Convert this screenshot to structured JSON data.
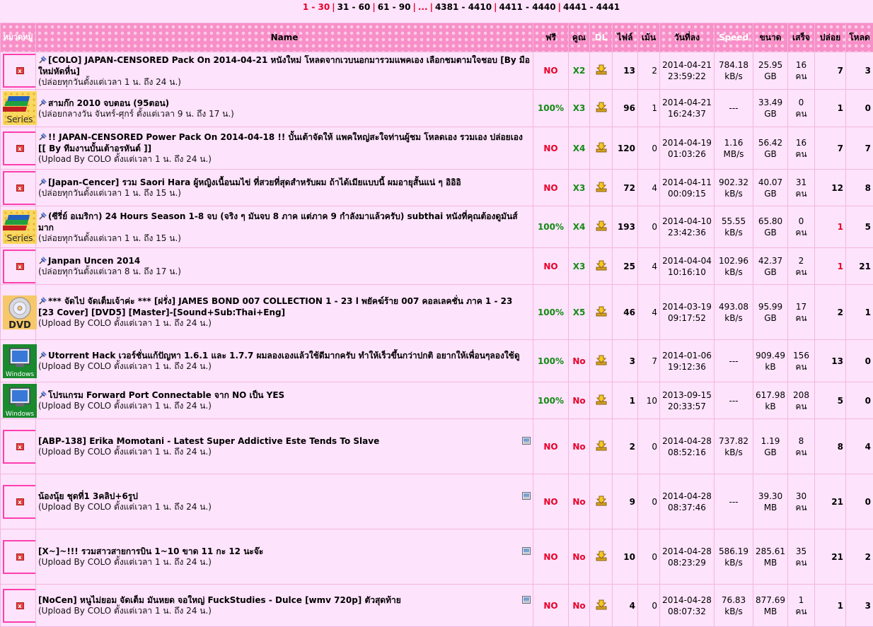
{
  "pager": [
    {
      "label": "1 - 30",
      "current": true
    },
    {
      "label": "31 - 60"
    },
    {
      "label": "61 - 90"
    },
    {
      "label": "...",
      "dots": true
    },
    {
      "label": "4381 - 4410"
    },
    {
      "label": "4411 - 4440"
    },
    {
      "label": "4441 - 4441"
    }
  ],
  "headers": {
    "category": "หมวดหมู่",
    "name": "Name",
    "free": "ฟรี",
    "multiplier": "คูณ",
    "dl": "DL",
    "files": "ไฟล์",
    "comments": "เม้น",
    "date": "วันที่ลง",
    "speed": "Speed",
    "size": "ขนาด",
    "completed": "เสร็จ",
    "seeders": "ปล่อย",
    "leechers": "โหลด"
  },
  "colors": {
    "header_bg": "#f88fc8",
    "row_bg": "#fde3fb",
    "red": "#e8002a",
    "green": "#138a13",
    "border_pink": "#ff3fb0"
  },
  "rows": [
    {
      "cat": "broken",
      "pinned": true,
      "new": false,
      "title": "[COLO] JAPAN-CENSORED Pack On 2014-04-21 หนังใหม่ โหลดจากเวบนอกมารวมแพคเอง เลือกชมตามใจชอบ [By มือใหม่หัดหื่น]",
      "sub": "(ปล่อยทุกวันตั้งแต่เวลา 1 น. ถึง 24 น.)",
      "free": "NO",
      "mult": "X2",
      "files": "13",
      "comments": "2",
      "date": "2014-04-21",
      "time": "23:59:22",
      "speed1": "784.18",
      "speed2": "kB/s",
      "size1": "25.95",
      "size2": "GB",
      "done1": "16",
      "done2": "คน",
      "seed": "7",
      "seed_red": false,
      "leech": "3",
      "h": 53
    },
    {
      "cat": "series",
      "cat_label": "Series",
      "pinned": true,
      "new": false,
      "title": "สามก๊ก 2010 จบตอน (95ตอน)",
      "sub": "(ปล่อยกลางวัน จันทร์-ศุกร์ ตั้งแต่เวลา 9 น. ถึง 17 น.)",
      "free": "100%",
      "mult": "X3",
      "files": "96",
      "comments": "1",
      "date": "2014-04-21",
      "time": "16:24:37",
      "speed1": "---",
      "speed2": "",
      "size1": "33.49",
      "size2": "GB",
      "done1": "0",
      "done2": "คน",
      "seed": "1",
      "seed_red": false,
      "leech": "0",
      "h": 53
    },
    {
      "cat": "broken",
      "pinned": true,
      "new": false,
      "title": "!! JAPAN-CENSORED Power Pack On 2014-04-18 !! บั้นเต้าจัดให้ แพคใหญ่สะใจท่านผู้ชม โหลดเอง รวมเอง ปล่อยเอง [[ By ทีมงานบั้นเต้าอรหันต์ ]]",
      "sub": "(Upload By COLO ตั้งแต่เวลา 1 น. ถึง 24 น.)",
      "free": "NO",
      "mult": "X4",
      "files": "120",
      "comments": "0",
      "date": "2014-04-19",
      "time": "01:03:26",
      "speed1": "1.16",
      "speed2": "MB/s",
      "size1": "56.42",
      "size2": "GB",
      "done1": "16",
      "done2": "คน",
      "seed": "7",
      "seed_red": false,
      "leech": "7",
      "h": 60
    },
    {
      "cat": "broken",
      "pinned": true,
      "new": false,
      "title": "[Japan-Cencer] รวม Saori Hara ผู้หญิงเนื้อนมไข่ ที่สวยที่สุดสำหรับผม ถ้าได้เมียแบบนี้ ผมอายุสั้นแน่ ๆ อิอิอิ",
      "sub": "(ปล่อยทุกวันตั้งแต่เวลา 1 น. ถึง 15 น.)",
      "free": "NO",
      "mult": "X3",
      "files": "72",
      "comments": "4",
      "date": "2014-04-11",
      "time": "00:09:15",
      "speed1": "902.32",
      "speed2": "kB/s",
      "size1": "40.07",
      "size2": "GB",
      "done1": "31",
      "done2": "คน",
      "seed": "12",
      "seed_red": false,
      "leech": "8",
      "h": 52
    },
    {
      "cat": "series",
      "cat_label": "Series",
      "pinned": true,
      "new": false,
      "title": "(ซีรี่ย์ อเมริกา) 24 Hours Season 1-8 จบ (จริง ๆ มันจบ 8 ภาค แต่ภาค 9 กำลังมาแล้วครับ) subthai หนังที่คุณต้องดูมันส์มาก",
      "sub": "(ปล่อยทุกวันตั้งแต่เวลา 1 น. ถึง 15 น.)",
      "free": "100%",
      "mult": "X4",
      "files": "193",
      "comments": "0",
      "date": "2014-04-10",
      "time": "23:42:36",
      "speed1": "55.55",
      "speed2": "kB/s",
      "size1": "65.80",
      "size2": "GB",
      "done1": "0",
      "done2": "คน",
      "seed": "1",
      "seed_red": true,
      "leech": "5",
      "h": 59
    },
    {
      "cat": "broken",
      "pinned": true,
      "new": false,
      "title": "Janpan Uncen 2014",
      "sub": "(ปล่อยทุกวันตั้งแต่เวลา 8 น. ถึง 17 น.)",
      "free": "NO",
      "mult": "X3",
      "files": "25",
      "comments": "4",
      "date": "2014-04-04",
      "time": "10:16:10",
      "speed1": "102.96",
      "speed2": "kB/s",
      "size1": "42.37",
      "size2": "GB",
      "done1": "2",
      "done2": "คน",
      "seed": "1",
      "seed_red": true,
      "leech": "21",
      "h": 52
    },
    {
      "cat": "dvd",
      "cat_label": "DVD",
      "pinned": true,
      "new": false,
      "title": "*** จัดไป จัดเต็มเจ้าค่ะ *** [ฝรั่ง] JAMES BOND 007 COLLECTION 1 - 23 l พยัคฆ์ร้าย 007 คอลเลคชั่น ภาค 1 - 23 [23 Cover] [DVD5] [Master]-[Sound+Sub:Thai+Eng]",
      "sub": "(Upload By COLO ตั้งแต่เวลา 1 น. ถึง 24 น.)",
      "free": "100%",
      "mult": "X5",
      "files": "46",
      "comments": "4",
      "date": "2014-03-19",
      "time": "09:17:52",
      "speed1": "493.08",
      "speed2": "kB/s",
      "size1": "95.99",
      "size2": "GB",
      "done1": "17",
      "done2": "คน",
      "seed": "2",
      "seed_red": false,
      "leech": "1",
      "h": 78
    },
    {
      "cat": "windows",
      "cat_label": "Windows",
      "pinned": true,
      "new": false,
      "title": "Utorrent Hack เวอร์ชั่นแก้ปัญหา 1.6.1 และ 1.7.7 ผมลองเองแล้วใช้ดีมากครับ ทำให้เร็วขึ้นกว่าปกติ อยากให้เพื่อนๆลองใช้ดู",
      "sub": "(Upload By COLO ตั้งแต่เวลา 1 น. ถึง 24 น.)",
      "free": "100%",
      "mult": "No",
      "mult_red": true,
      "files": "3",
      "comments": "7",
      "date": "2014-01-06",
      "time": "19:12:36",
      "speed1": "---",
      "speed2": "",
      "size1": "909.49",
      "size2": "kB",
      "done1": "156",
      "done2": "คน",
      "seed": "13",
      "seed_red": false,
      "leech": "0",
      "h": 60
    },
    {
      "cat": "windows",
      "cat_label": "Windows",
      "pinned": true,
      "new": false,
      "title": "โปรแกรม Forward Port Connectable จาก NO เป็น YES",
      "sub": "(Upload By COLO ตั้งแต่เวลา 1 น. ถึง 24 น.)",
      "free": "100%",
      "mult": "No",
      "mult_red": true,
      "files": "1",
      "comments": "10",
      "date": "2013-09-15",
      "time": "20:33:57",
      "speed1": "---",
      "speed2": "",
      "size1": "617.98",
      "size2": "kB",
      "done1": "208",
      "done2": "คน",
      "seed": "5",
      "seed_red": false,
      "leech": "0",
      "h": 52
    },
    {
      "cat": "broken",
      "pinned": false,
      "new": true,
      "title": "[ABP-138] Erika Momotani - Latest Super Addictive Este Tends To Slave",
      "sub": "(Upload By COLO ตั้งแต่เวลา 1 น. ถึง 24 น.)",
      "free": "NO",
      "mult": "No",
      "mult_red": true,
      "files": "2",
      "comments": "0",
      "date": "2014-04-28",
      "time": "08:52:16",
      "speed1": "737.82",
      "speed2": "kB/s",
      "size1": "1.19",
      "size2": "GB",
      "done1": "8",
      "done2": "คน",
      "seed": "8",
      "seed_red": false,
      "leech": "4",
      "h": 78
    },
    {
      "cat": "broken",
      "pinned": false,
      "new": true,
      "title": "น้องนุ้ย ชุดที่1 3คลิป+6รูป",
      "sub": "(Upload By COLO ตั้งแต่เวลา 1 น. ถึง 24 น.)",
      "free": "NO",
      "mult": "No",
      "mult_red": true,
      "files": "9",
      "comments": "0",
      "date": "2014-04-28",
      "time": "08:37:46",
      "speed1": "---",
      "speed2": "",
      "size1": "39.30",
      "size2": "MB",
      "done1": "30",
      "done2": "คน",
      "seed": "21",
      "seed_red": false,
      "leech": "0",
      "h": 78
    },
    {
      "cat": "broken",
      "pinned": false,
      "new": true,
      "title": "[X~]~!!! รวมสาวสายการบิน 1~10 ขาด 11 กะ 12 นะจ๊ะ",
      "sub": "(Upload By COLO ตั้งแต่เวลา 1 น. ถึง 24 น.)",
      "free": "NO",
      "mult": "No",
      "mult_red": true,
      "files": "10",
      "comments": "0",
      "date": "2014-04-28",
      "time": "08:23:29",
      "speed1": "586.19",
      "speed2": "kB/s",
      "size1": "285.61",
      "size2": "MB",
      "done1": "35",
      "done2": "คน",
      "seed": "21",
      "seed_red": false,
      "leech": "2",
      "h": 78
    },
    {
      "cat": "broken",
      "pinned": false,
      "new": true,
      "title": "[NoCen] หนูไม่ยอม จัดเต็ม มันหยด จอใหญ่ FuckStudies - Dulce [wmv 720p] ตัวสุดท้าย",
      "sub": "(Upload By COLO ตั้งแต่เวลา 1 น. ถึง 24 น.)",
      "free": "NO",
      "mult": "No",
      "mult_red": true,
      "files": "4",
      "comments": "0",
      "date": "2014-04-28",
      "time": "08:07:32",
      "speed1": "76.83",
      "speed2": "kB/s",
      "size1": "877.69",
      "size2": "MB",
      "done1": "1",
      "done2": "คน",
      "seed": "1",
      "seed_red": false,
      "leech": "3",
      "h": 60
    }
  ]
}
